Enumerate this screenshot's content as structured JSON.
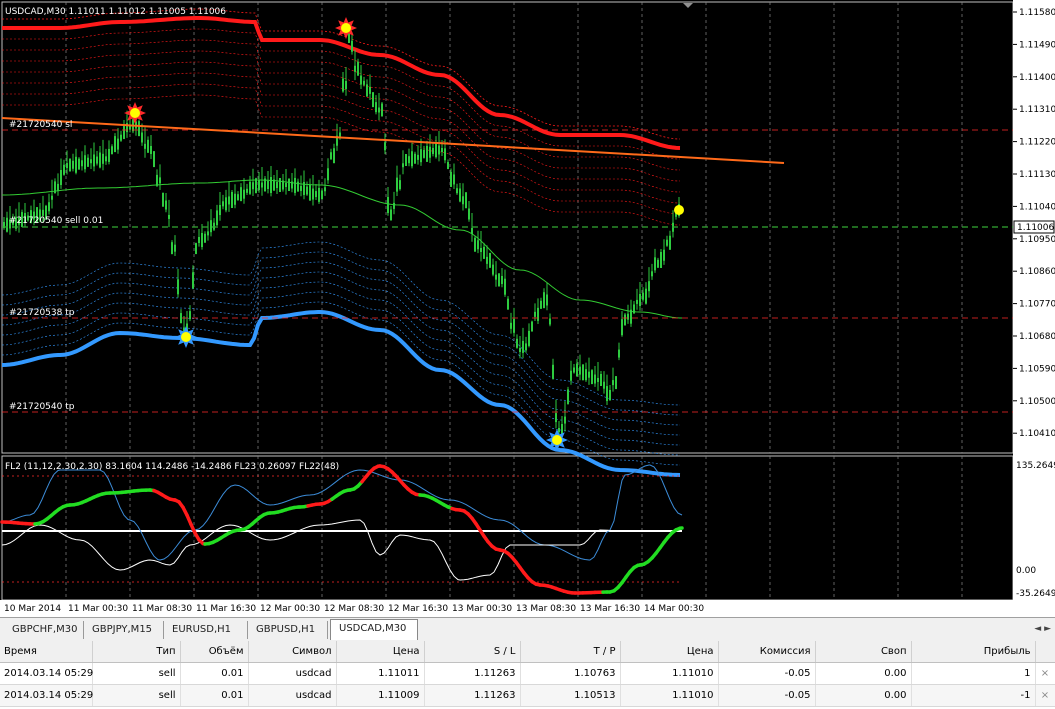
{
  "chart": {
    "title": "USDCAD,M30  1.11011 1.11012 1.11005 1.11006",
    "price_levels": [
      "1.11580",
      "1.11490",
      "1.11400",
      "1.11310",
      "1.11220",
      "1.11130",
      "1.11040",
      "1.10950",
      "1.10860",
      "1.10770",
      "1.10680",
      "1.10590",
      "1.10500",
      "1.10410"
    ],
    "current_price": "1.11006",
    "time_labels": [
      "10 Mar 2014",
      "11 Mar 00:30",
      "11 Mar 08:30",
      "11 Mar 16:30",
      "12 Mar 00:30",
      "12 Mar 08:30",
      "12 Mar 16:30",
      "13 Mar 00:30",
      "13 Mar 08:30",
      "13 Mar 16:30",
      "14 Mar 00:30"
    ],
    "order_labels": {
      "sl": "#21720540 sl",
      "sell": "#21720540 sell 0.01",
      "tp1": "#21720538 tp",
      "tp2": "#21720540 tp"
    },
    "indicator_title": "FL2 (11,12,2.30,2.30) 83.1604 114.2486 -14.2486  FL23 0.26097  FL22(48)",
    "indicator_levels": [
      "135.2649",
      "0.00",
      "-35.2649"
    ],
    "colors": {
      "candle": "#2ecc40",
      "upper_band": "#ff1a1a",
      "lower_band": "#3399ff",
      "trendline": "#ff6a1a",
      "ma": "#33cc33",
      "signal": "#ffff00"
    }
  },
  "symbol_tabs": [
    {
      "label": "GBPCHF,M30",
      "active": false
    },
    {
      "label": "GBPJPY,M15",
      "active": false
    },
    {
      "label": "EURUSD,H1",
      "active": false
    },
    {
      "label": "GBPUSD,H1",
      "active": false
    },
    {
      "label": "USDCAD,M30",
      "active": true
    }
  ],
  "tab_arrows": "◄ ►",
  "orders": {
    "columns": [
      "Время",
      "Тип",
      "Объём",
      "Символ",
      "Цена",
      "S / L",
      "T / P",
      "Цена",
      "Комиссия",
      "Своп",
      "Прибыль"
    ],
    "rows": [
      [
        "2014.03.14 05:29",
        "sell",
        "0.01",
        "usdcad",
        "1.11011",
        "1.11263",
        "1.10763",
        "1.11010",
        "-0.05",
        "0.00",
        "1"
      ],
      [
        "2014.03.14 05:29",
        "sell",
        "0.01",
        "usdcad",
        "1.11009",
        "1.11263",
        "1.10513",
        "1.11010",
        "-0.05",
        "0.00",
        "-1"
      ]
    ],
    "close_icon": "×"
  }
}
